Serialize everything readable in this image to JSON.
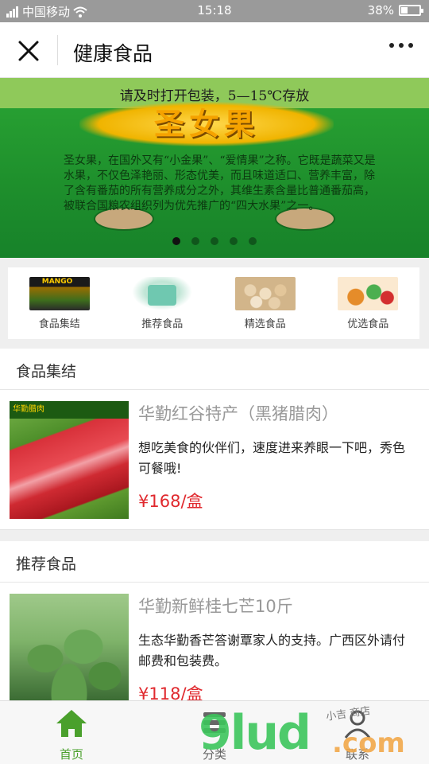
{
  "status": {
    "carrier": "中国移动",
    "time": "15:18",
    "battery": "38%",
    "battery_level": 0.38
  },
  "nav": {
    "title": "健康食品"
  },
  "banner": {
    "top_line": "请及时打开包装，5—15℃存放",
    "brand": "圣女果",
    "paragraph": "圣女果，在国外又有“小金果”、“爱情果”之称。它既是蔬菜又是水果，不仅色泽艳丽、形态优美，而且味道适口、营养丰富，除了含有番茄的所有营养成分之外，其维生素含量比普通番茄高，被联合国粮农组织列为优先推广的“四大水果”之一。",
    "dots": 5,
    "active_dot": 0
  },
  "categories": [
    {
      "label": "食品集结",
      "icon": "mango-box-icon"
    },
    {
      "label": "推荐食品",
      "icon": "yogurt-icon"
    },
    {
      "label": "精选食品",
      "icon": "eggs-icon"
    },
    {
      "label": "优选食品",
      "icon": "dish-icon"
    }
  ],
  "sections": [
    {
      "title": "食品集结",
      "product": {
        "image_tag": "华勤腊肉",
        "name": "华勤红谷特产（黑猪腊肉）",
        "desc": "想吃美食的伙伴们，速度进来养眼一下吧，秀色可餐哦!",
        "price": "¥168/盒"
      }
    },
    {
      "title": "推荐食品",
      "product": {
        "name": "华勤新鲜桂七芒10斤",
        "desc": "生态华勤香芒答谢覃家人的支持。广西区外请付邮费和包装费。",
        "price": "¥118/盒"
      }
    }
  ],
  "tabs": [
    {
      "label": "首页",
      "icon": "home-icon",
      "active": true
    },
    {
      "label": "分类",
      "icon": "category-icon",
      "active": false
    },
    {
      "label": "联系",
      "icon": "contact-icon",
      "active": false
    }
  ],
  "watermark": {
    "main": "9lud",
    "tld": ".com",
    "small": "小吉 商店"
  },
  "colors": {
    "accent": "#4aa02c",
    "price": "#e0292e"
  }
}
